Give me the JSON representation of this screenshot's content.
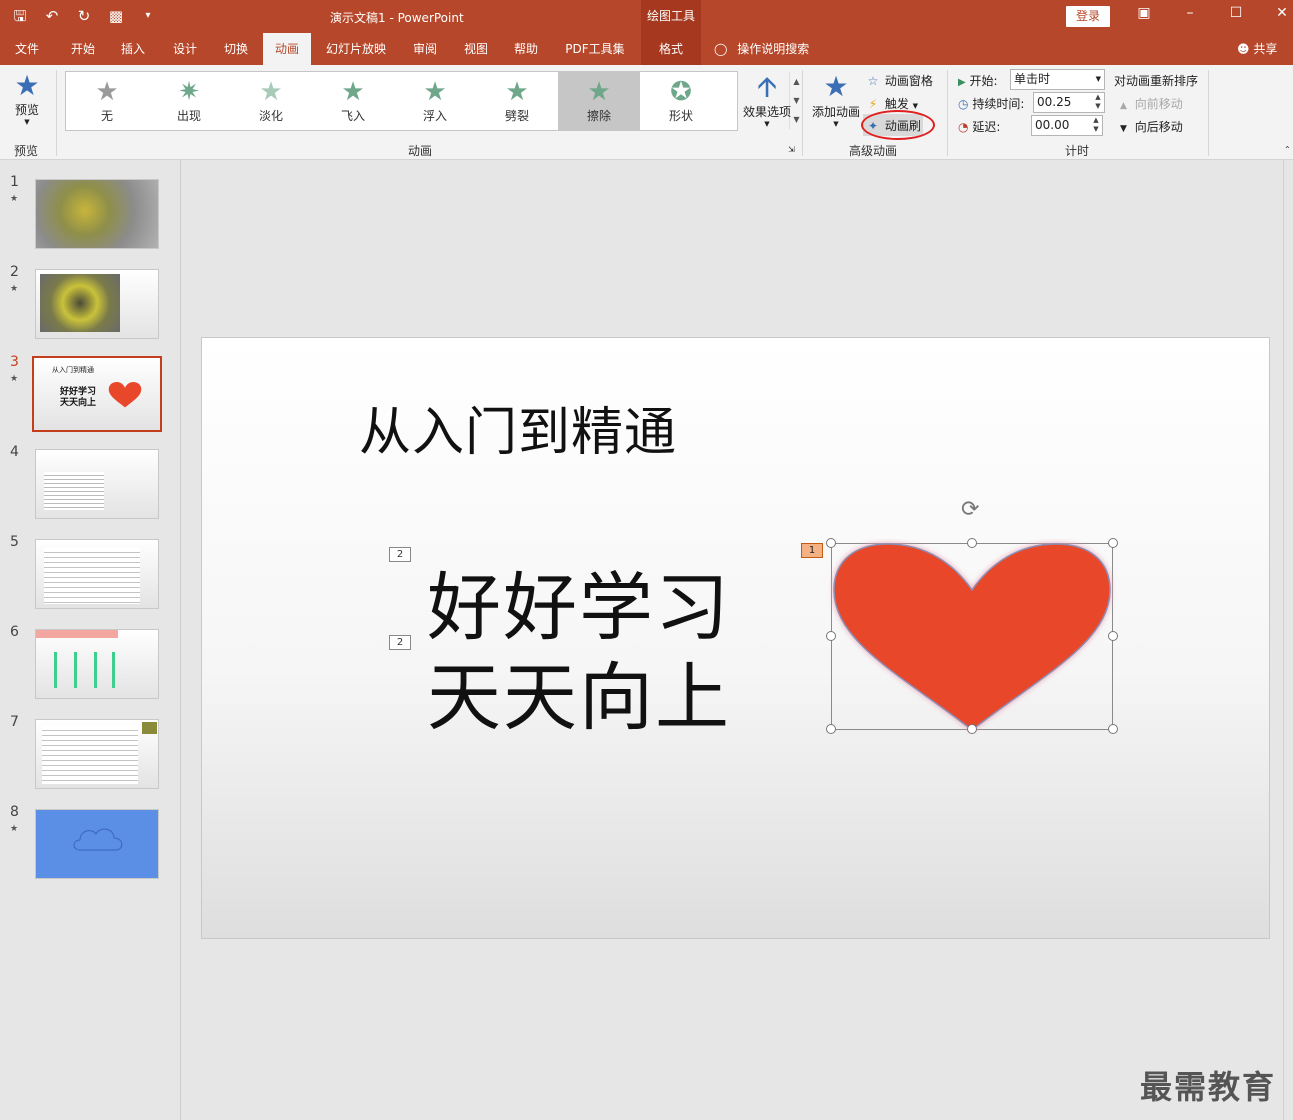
{
  "window": {
    "doc_title": "演示文稿1  -  PowerPoint",
    "context_tool": "绘图工具",
    "login": "登录"
  },
  "tabs": [
    "文件",
    "开始",
    "插入",
    "设计",
    "切换",
    "动画",
    "幻灯片放映",
    "审阅",
    "视图",
    "帮助",
    "PDF工具集",
    "格式"
  ],
  "active_tab": "动画",
  "tell_me": "操作说明搜索",
  "share": "共享",
  "ribbon": {
    "preview": {
      "label": "预览",
      "group": "预览"
    },
    "animations_group": "动画",
    "gallery": [
      "无",
      "出现",
      "淡化",
      "飞入",
      "浮入",
      "劈裂",
      "擦除",
      "形状"
    ],
    "gallery_selected": "擦除",
    "effect_options": "效果选项",
    "advanced": {
      "group": "高级动画",
      "add_animation": "添加动画",
      "animation_pane": "动画窗格",
      "trigger": "触发",
      "painter": "动画刷"
    },
    "timing": {
      "group": "计时",
      "start_label": "开始:",
      "start_value": "单击时",
      "duration_label": "持续时间:",
      "duration_value": "00.25",
      "delay_label": "延迟:",
      "delay_value": "00.00",
      "reorder_title": "对动画重新排序",
      "move_earlier": "向前移动",
      "move_later": "向后移动"
    }
  },
  "thumbnails": [
    {
      "num": "1",
      "star": "★"
    },
    {
      "num": "2",
      "star": "★"
    },
    {
      "num": "3",
      "star": "★",
      "title": "从入门到精通",
      "line1": "好好学习",
      "line2": "天天向上"
    },
    {
      "num": "4",
      "star": ""
    },
    {
      "num": "5",
      "star": ""
    },
    {
      "num": "6",
      "star": ""
    },
    {
      "num": "7",
      "star": ""
    },
    {
      "num": "8",
      "star": "★"
    }
  ],
  "slide": {
    "title": "从入门到精通",
    "line1": "好好学习",
    "line2": "天天向上",
    "tag_text1": "2",
    "tag_text2": "2",
    "tag_heart": "1"
  },
  "watermark": "最需教育",
  "colors": {
    "accent": "#b7472a",
    "heart": "#e8472a",
    "slide8": "#5b8fe6"
  }
}
